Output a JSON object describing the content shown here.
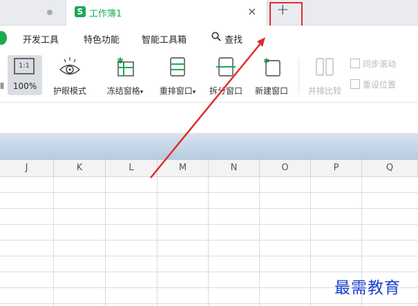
{
  "tabs": {
    "active_title": "工作簿1",
    "app_icon_letter": "S",
    "close_glyph": "×",
    "new_tab_glyph": "+"
  },
  "menu": {
    "items": [
      "开发工具",
      "特色功能",
      "智能工具箱",
      "查找"
    ]
  },
  "toolbar": {
    "left_cut_label": "Ⅱ",
    "zoom_icon_text": "1:1",
    "zoom_label": "100%",
    "eye_label": "护眼模式",
    "freeze_label": "冻结窗格",
    "rearrange_label": "重排窗口",
    "split_label": "拆分窗口",
    "new_window_label": "新建窗口",
    "side_by_side_label": "并排比较",
    "sync_scroll_label": "同步滚动",
    "reset_position_label": "重设位置",
    "dropdown_glyph": "▾"
  },
  "sheet": {
    "columns": [
      "J",
      "K",
      "L",
      "M",
      "N",
      "O",
      "P",
      "Q"
    ]
  },
  "watermark": "最需教育",
  "colors": {
    "accent_green": "#1aaa55",
    "highlight_red": "#e02b2b",
    "watermark_blue": "#1a3fcf"
  }
}
